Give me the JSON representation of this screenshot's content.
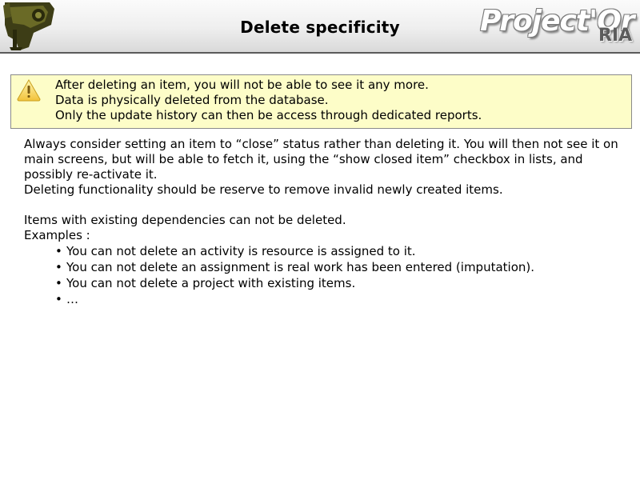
{
  "header": {
    "title": "Delete specificity",
    "brand_main": "Project'Or",
    "brand_sub": "RIA",
    "logo_icon": "projector-logo-icon"
  },
  "warning": {
    "icon": "warning-triangle-icon",
    "lines": [
      "After deleting an item, you will not be able to see it any more.",
      "Data is physically deleted from the database.",
      "Only the update history can then be access through dedicated reports."
    ]
  },
  "body": {
    "paragraph1": "Always consider setting an item to “close” status rather than deleting it. You will then not see it on main screens, but will be able to fetch it, using the “show closed item” checkbox in lists, and possibly re-activate it.",
    "paragraph2": "Deleting functionality should be reserve to remove invalid newly created items.",
    "paragraph3": "Items with existing dependencies can not be deleted.",
    "examples_label": "Examples :",
    "bullet_char": "•",
    "bullets": [
      "You can not delete an activity is resource is assigned to it.",
      "You can not delete an assignment is real work has been entered (imputation).",
      "You can not delete a project with existing items.",
      "…"
    ]
  },
  "colors": {
    "warning_background": "#fdfdc8",
    "header_border": "#5b5b5b",
    "logo_olive": "#4a4a1a"
  }
}
